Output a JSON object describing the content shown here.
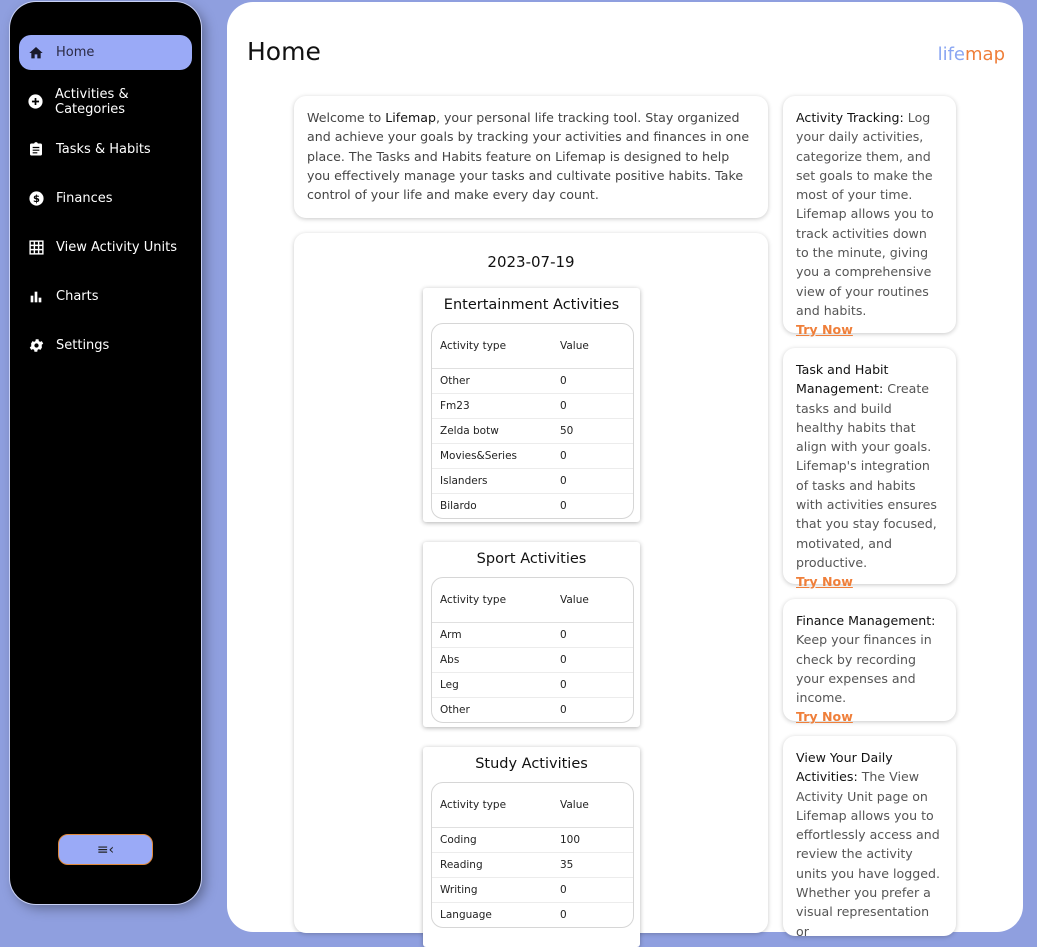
{
  "sidebar": {
    "items": [
      {
        "label": "Home",
        "icon": "home-icon",
        "active": true
      },
      {
        "label": "Activities & Categories",
        "icon": "plus-circle-icon"
      },
      {
        "label": "Tasks & Habits",
        "icon": "clipboard-icon"
      },
      {
        "label": "Finances",
        "icon": "dollar-circle-icon"
      },
      {
        "label": "View Activity Units",
        "icon": "grid-icon"
      },
      {
        "label": "Charts",
        "icon": "bar-chart-icon"
      },
      {
        "label": "Settings",
        "icon": "gear-icon"
      }
    ],
    "collapse_icon": "≡‹"
  },
  "header": {
    "title": "Home",
    "brand_part1": "life",
    "brand_part2": "map"
  },
  "welcome": {
    "pre": "Welcome to ",
    "brand": "Lifemap",
    "post": ", your personal life tracking tool. Stay organized and achieve your goals by tracking your activities and finances in one place. The Tasks and Habits feature on Lifemap is designed to help you effectively manage your tasks and cultivate positive habits. Take control of your life and make every day count."
  },
  "activities": {
    "date": "2023-07-19",
    "col_type": "Activity type",
    "col_value": "Value",
    "categories": [
      {
        "title": "Entertainment Activities",
        "rows": [
          {
            "type": "Other",
            "value": "0"
          },
          {
            "type": "Fm23",
            "value": "0"
          },
          {
            "type": "Zelda botw",
            "value": "50"
          },
          {
            "type": "Movies&Series",
            "value": "0"
          },
          {
            "type": "Islanders",
            "value": "0"
          },
          {
            "type": "Bilardo",
            "value": "0"
          }
        ]
      },
      {
        "title": "Sport Activities",
        "rows": [
          {
            "type": "Arm",
            "value": "0"
          },
          {
            "type": "Abs",
            "value": "0"
          },
          {
            "type": "Leg",
            "value": "0"
          },
          {
            "type": "Other",
            "value": "0"
          }
        ]
      },
      {
        "title": "Study Activities",
        "rows": [
          {
            "type": "Coding",
            "value": "100"
          },
          {
            "type": "Reading",
            "value": "35"
          },
          {
            "type": "Writing",
            "value": "0"
          },
          {
            "type": "Language",
            "value": "0"
          }
        ]
      }
    ]
  },
  "features": [
    {
      "title": "Activity Tracking:",
      "text": " Log your daily activities, categorize them, and set goals to make the most of your time. Lifemap allows you to track activities down to the minute, giving you a comprehensive view of your routines and habits.",
      "cta": "Try Now"
    },
    {
      "title": "Task and Habit Management:",
      "text": " Create tasks and build healthy habits that align with your goals. Lifemap's integration of tasks and habits with activities ensures that you stay focused, motivated, and productive.",
      "cta": "Try Now"
    },
    {
      "title": "Finance Management:",
      "text": " Keep your finances in check by recording your expenses and income.",
      "cta": "Try Now"
    },
    {
      "title": "View Your Daily Activities:",
      "text": " The View Activity Unit page on Lifemap allows you to effortlessly access and review the activity units you have logged. Whether you prefer a visual representation or",
      "cta": ""
    }
  ]
}
